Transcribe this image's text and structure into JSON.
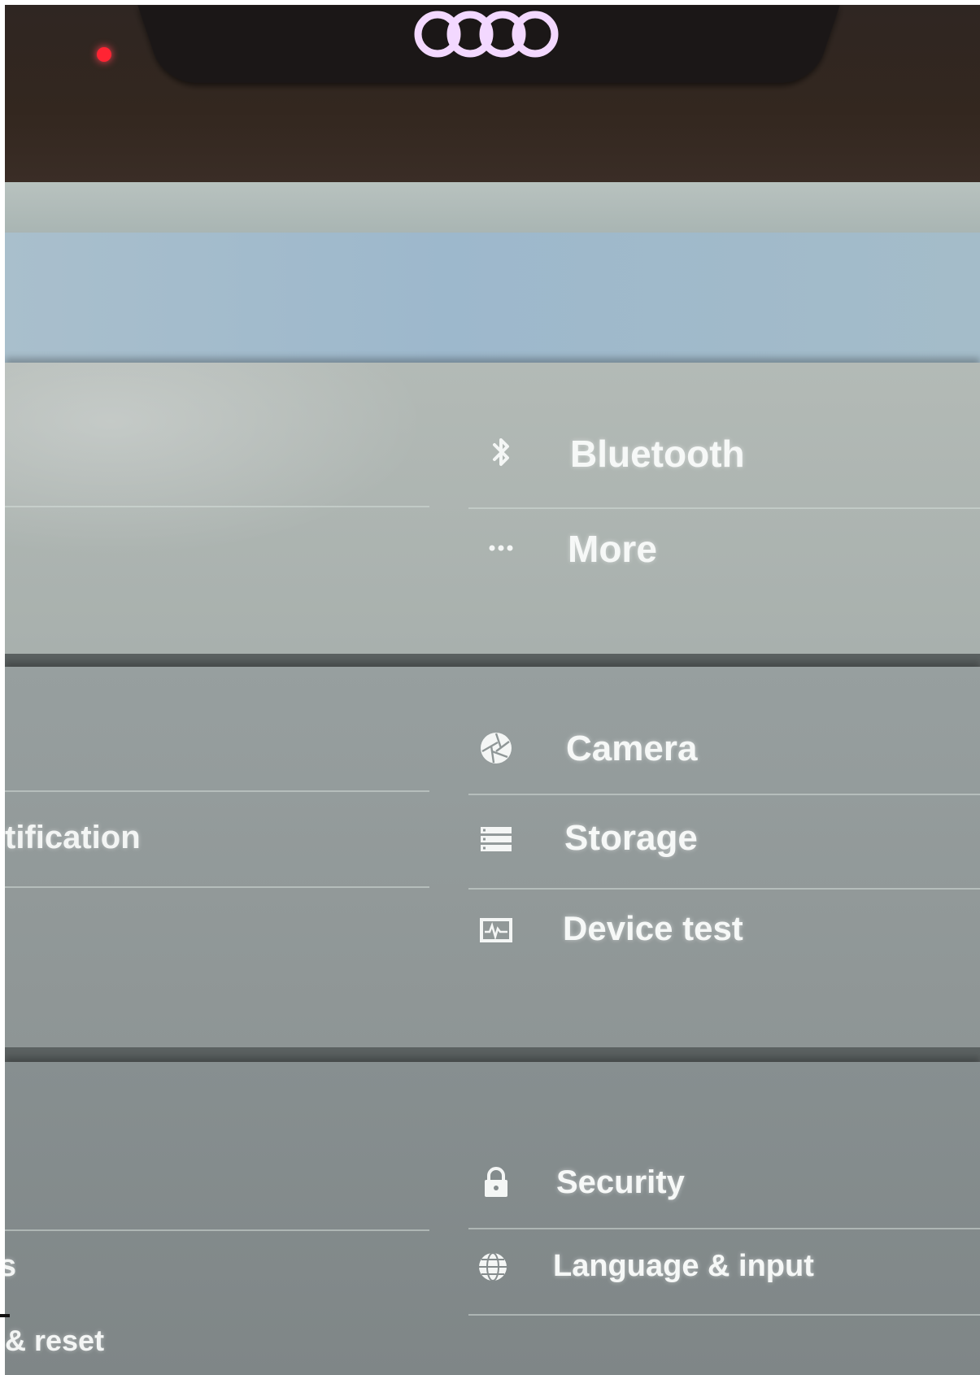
{
  "colors": {
    "led": "#ff2433",
    "logo": "#f3d8ff",
    "text": "#f6f8f7"
  },
  "device": {
    "logo_icon": "four-rings-logo",
    "led_icon": "status-led"
  },
  "settings": {
    "right_column": [
      {
        "label": "Bluetooth",
        "icon": "bluetooth-icon"
      },
      {
        "label": "More",
        "icon": "more-dots-icon"
      },
      {
        "label": "Camera",
        "icon": "camera-aperture-icon"
      },
      {
        "label": "Storage",
        "icon": "storage-icon"
      },
      {
        "label": "Device test",
        "icon": "device-test-icon"
      },
      {
        "label": "Security",
        "icon": "lock-icon"
      },
      {
        "label": "Language & input",
        "icon": "globe-icon"
      }
    ],
    "left_column": [
      {
        "label": "tification"
      },
      {
        "label": "s"
      },
      {
        "label": "& reset"
      }
    ]
  }
}
